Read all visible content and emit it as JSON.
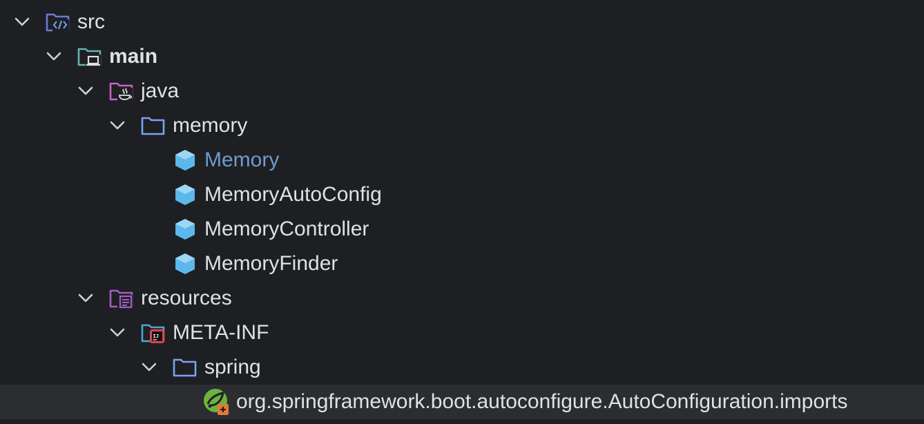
{
  "tree": {
    "items": [
      {
        "label": "src",
        "icon": "source-folder-icon",
        "expanded": true
      },
      {
        "label": "main",
        "icon": "module-folder-icon",
        "expanded": true
      },
      {
        "label": "java",
        "icon": "java-source-folder-icon",
        "expanded": true
      },
      {
        "label": "memory",
        "icon": "package-folder-icon",
        "expanded": true
      },
      {
        "label": "Memory",
        "icon": "java-class-icon"
      },
      {
        "label": "MemoryAutoConfig",
        "icon": "java-class-icon"
      },
      {
        "label": "MemoryController",
        "icon": "java-class-icon"
      },
      {
        "label": "MemoryFinder",
        "icon": "java-class-icon"
      },
      {
        "label": "resources",
        "icon": "resources-folder-icon",
        "expanded": true
      },
      {
        "label": "META-INF",
        "icon": "meta-inf-folder-icon",
        "expanded": true
      },
      {
        "label": "spring",
        "icon": "folder-icon",
        "expanded": true
      },
      {
        "label": "org.springframework.boot.autoconfigure.AutoConfiguration.imports",
        "icon": "spring-config-file-icon",
        "selected": true
      }
    ]
  },
  "colors": {
    "background": "#1e1f22",
    "selected_row": "#2b2d30",
    "text": "#dfe1e5",
    "modified_text": "#6f9bd1",
    "chevron": "#cfd1d6",
    "source_folder": "#6e7ad8",
    "module_folder": "#5fb8b0",
    "java_folder": "#c464c8",
    "package_folder": "#7aa2f7",
    "class_icon": "#5cb8ea"
  }
}
